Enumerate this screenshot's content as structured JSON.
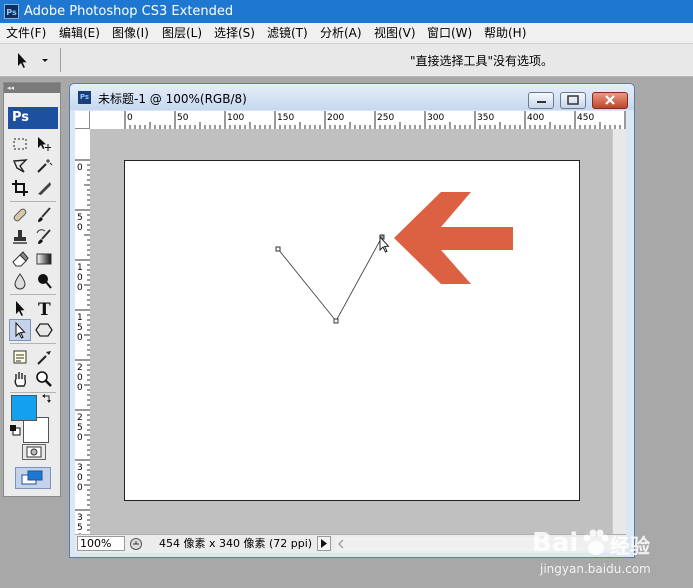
{
  "window": {
    "title": "Adobe Photoshop CS3 Extended",
    "app_icon": "Ps"
  },
  "menu": [
    "文件(F)",
    "编辑(E)",
    "图像(I)",
    "图层(L)",
    "选择(S)",
    "滤镜(T)",
    "分析(A)",
    "视图(V)",
    "窗口(W)",
    "帮助(H)"
  ],
  "options_bar": {
    "message": "\"直接选择工具\"没有选项。"
  },
  "toolbox": {
    "logo": "Ps",
    "tools": [
      "marquee-tool",
      "move-tool",
      "lasso-tool",
      "magic-wand-tool",
      "crop-tool",
      "slice-tool",
      "healing-brush-tool",
      "brush-tool",
      "clone-stamp-tool",
      "history-brush-tool",
      "eraser-tool",
      "gradient-tool",
      "blur-tool",
      "dodge-tool",
      "path-selection-tool",
      "type-tool",
      "direct-selection-tool",
      "shape-tool",
      "notes-tool",
      "eyedropper-tool",
      "hand-tool",
      "zoom-tool"
    ],
    "selected_tool": "direct-selection-tool",
    "foreground_color": "#12a0f0",
    "background_color": "#ffffff"
  },
  "document": {
    "title": "未标题-1 @ 100%(RGB/8)",
    "ruler_top_labels": [
      "0",
      "50",
      "100",
      "150",
      "200",
      "250",
      "300",
      "350",
      "400",
      "450"
    ],
    "ruler_left_labels": [
      "0",
      "50",
      "100",
      "150",
      "200",
      "250",
      "300",
      "350"
    ],
    "zoom": "100%",
    "status": "454 像素 x 340 像素 (72 ppi)"
  },
  "annotation": {
    "arrow_color": "#dc6042"
  },
  "watermark": {
    "brand": "Bai",
    "brand2": "经验",
    "url": "jingyan.baidu.com"
  }
}
